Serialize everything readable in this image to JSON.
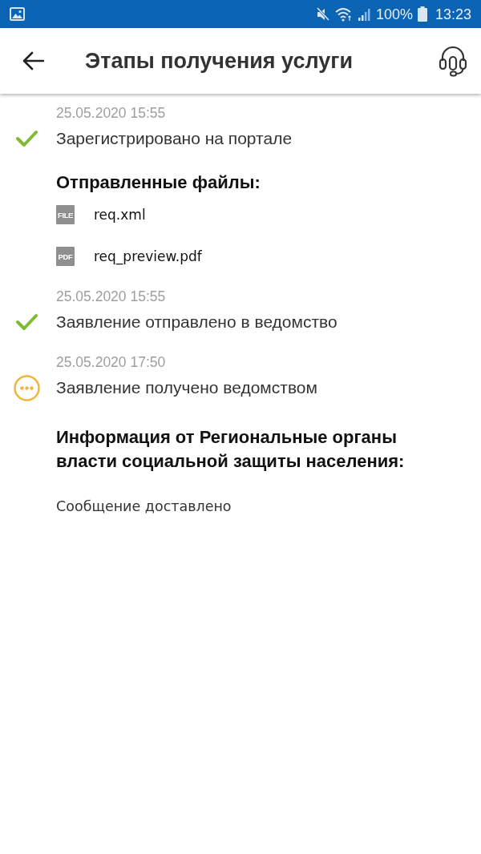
{
  "status_bar": {
    "battery": "100%",
    "time": "13:23"
  },
  "app_bar": {
    "title": "Этапы получения услуги"
  },
  "steps": [
    {
      "date": "25.05.2020 15:55",
      "title": "Зарегистрировано на портале",
      "kind": "done",
      "files_heading": "Отправленные файлы:",
      "files": [
        {
          "type_label": "FILE",
          "name": "req.xml"
        },
        {
          "type_label": "PDF",
          "name": "req_preview.pdf"
        }
      ]
    },
    {
      "date": "25.05.2020 15:55",
      "title": "Заявление отправлено в ведомство",
      "kind": "done"
    },
    {
      "date": "25.05.2020 17:50",
      "title": "Заявление получено ведомством",
      "kind": "pending",
      "info_heading": "Информация от Региональные органы власти социальной защиты населения:",
      "message": "Сообщение доставлено"
    }
  ]
}
